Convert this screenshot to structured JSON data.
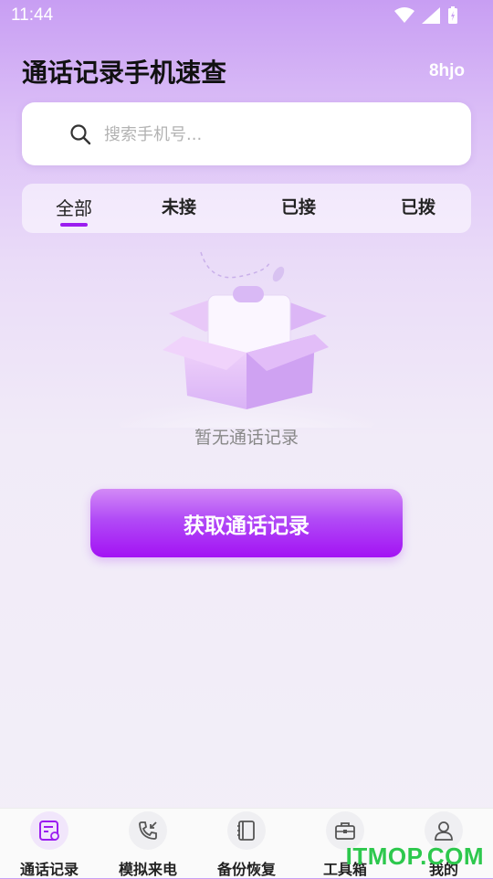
{
  "status_bar": {
    "time": "11:44",
    "icons": [
      "wifi-icon",
      "signal-icon",
      "battery-charging-icon"
    ]
  },
  "header": {
    "title": "通话记录手机速查",
    "user_id": "8hjo"
  },
  "search": {
    "placeholder": "搜索手机号..."
  },
  "tabs": [
    {
      "label": "全部",
      "active": true
    },
    {
      "label": "未接",
      "active": false
    },
    {
      "label": "已接",
      "active": false
    },
    {
      "label": "已拨",
      "active": false
    }
  ],
  "empty_state": {
    "illustration": "empty-box-icon",
    "message": "暂无通话记录"
  },
  "fetch_button": {
    "label": "获取通话记录"
  },
  "bottom_nav": [
    {
      "label": "通话记录",
      "icon": "call-log-icon",
      "active": true
    },
    {
      "label": "模拟来电",
      "icon": "incoming-call-icon",
      "active": false
    },
    {
      "label": "备份恢复",
      "icon": "notebook-icon",
      "active": false
    },
    {
      "label": "工具箱",
      "icon": "toolbox-icon",
      "active": false
    },
    {
      "label": "我的",
      "icon": "user-icon",
      "active": false
    }
  ],
  "watermark": "ITMOP.COM",
  "colors": {
    "accent": "#a312f4",
    "tab_underline": "#9b1cf0",
    "watermark": "#2dc84d"
  }
}
